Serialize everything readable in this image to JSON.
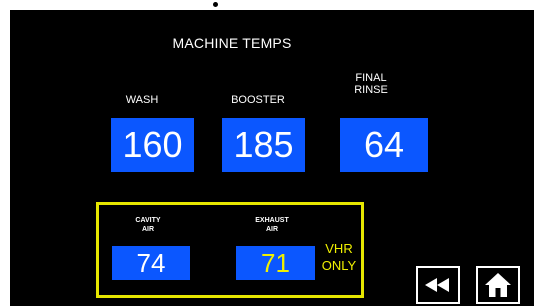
{
  "screen": {
    "title": "MACHINE TEMPS"
  },
  "temps": {
    "wash_label": "WASH",
    "wash_value": "160",
    "booster_label": "BOOSTER",
    "booster_value": "185",
    "final_rinse_label_line1": "FINAL",
    "final_rinse_label_line2": "RINSE",
    "final_rinse_value": "64"
  },
  "vhr": {
    "cavity_label_line1": "CAVITY",
    "cavity_label_line2": "AIR",
    "cavity_value": "74",
    "exhaust_label_line1": "EXHAUST",
    "exhaust_label_line2": "AIR",
    "exhaust_value": "71",
    "note_line1": "VHR",
    "note_line2": "ONLY"
  },
  "nav": {
    "back_icon": "rewind-icon",
    "home_icon": "home-icon"
  },
  "colors": {
    "background": "#000000",
    "value_box": "#0b57ff",
    "highlight": "#e6e600",
    "text": "#ffffff"
  }
}
